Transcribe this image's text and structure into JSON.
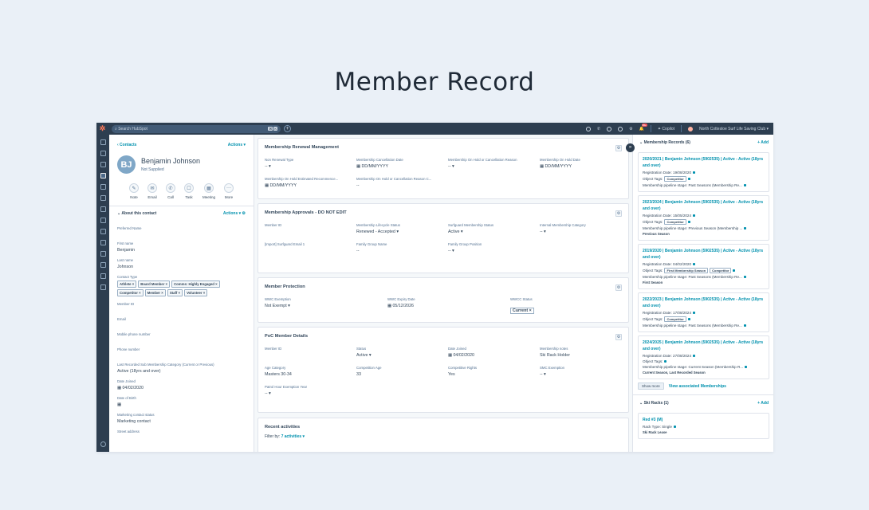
{
  "page_title": "Member Record",
  "topbar": {
    "search_placeholder": "Search HubSpot",
    "kbd1": "⌘",
    "kbd2": "K",
    "notif_count": "99+",
    "copilot": "Copilot",
    "account": "North Cottesloe Surf Life Saving Club ▾"
  },
  "contact": {
    "breadcrumb": "‹ Contacts",
    "actions": "Actions ▾",
    "initials": "BJ",
    "name": "Benjamin Johnson",
    "subtitle": "Not Supplied",
    "quick_actions": [
      "Note",
      "Email",
      "Call",
      "Task",
      "Meeting",
      "More"
    ],
    "about_title": "About this contact",
    "about_actions": "Actions ▾",
    "fields": {
      "preferred_name": {
        "label": "Preferred Name",
        "value": ""
      },
      "first_name": {
        "label": "First name",
        "value": "Benjamin"
      },
      "last_name": {
        "label": "Last name",
        "value": "Johnson"
      },
      "contact_type": {
        "label": "Contact Type"
      },
      "member_id": {
        "label": "Member ID",
        "value": ""
      },
      "email": {
        "label": "Email",
        "value": ""
      },
      "mobile": {
        "label": "Mobile phone number",
        "value": ""
      },
      "phone": {
        "label": "Phone number",
        "value": ""
      },
      "last_category": {
        "label": "Last Recorded Sub Membership Category (Current or Previous)",
        "value": "Active (18yrs and over)"
      },
      "date_joined": {
        "label": "Date Joined",
        "value": "04/02/2020"
      },
      "dob": {
        "label": "Date of Birth",
        "value": ""
      },
      "marketing_status": {
        "label": "Marketing contact status",
        "value": "Marketing contact"
      },
      "street": {
        "label": "Street address",
        "value": ""
      }
    },
    "contact_tags": [
      "Athlete ×",
      "Board Member ×",
      "Comms: Highly Engaged ×",
      "Competitor ×",
      "Member ×",
      "Staff ×",
      "Volunteer ×"
    ]
  },
  "cards": {
    "renewal": {
      "title": "Membership Renewal Management",
      "fields": [
        {
          "label": "Non Renewal Type",
          "value": "-- ▾"
        },
        {
          "label": "Membership Cancellation Date",
          "value": "▦ DD/MM/YYYY"
        },
        {
          "label": "Membership On Hold or Cancellation Reason",
          "value": "-- ▾"
        },
        {
          "label": "Membership On Hold Date",
          "value": "▦ DD/MM/YYYY"
        },
        {
          "label": "Membership On Hold Estimated Recommence...",
          "value": "▦ DD/MM/YYYY"
        },
        {
          "label": "Membership On Hold or Cancellation Reason C...",
          "value": "--"
        }
      ]
    },
    "approvals": {
      "title": "Membership Approvals - DO NOT EDIT",
      "fields": [
        {
          "label": "Member ID",
          "value": ""
        },
        {
          "label": "Membership Lifecycle Status",
          "value": "Renewed - Accepted ▾"
        },
        {
          "label": "Surfguard Membership Status",
          "value": "Active ▾"
        },
        {
          "label": "Internal Membership Category",
          "value": "-- ▾"
        },
        {
          "label": "[Import] Surfguard Email 1",
          "value": ""
        },
        {
          "label": "Family Group Name",
          "value": "--"
        },
        {
          "label": "Family Group Position",
          "value": "-- ▾"
        }
      ]
    },
    "protection": {
      "title": "Member Protection",
      "fields": [
        {
          "label": "WWC Exemption",
          "value": "Not Exempt ▾"
        },
        {
          "label": "WWC Expiry Date",
          "value": "▦ 05/12/2026"
        },
        {
          "label": "WWCC Status",
          "value": "Current ×"
        }
      ]
    },
    "poc": {
      "title": "PoC Member Details",
      "fields": [
        {
          "label": "Member ID",
          "value": ""
        },
        {
          "label": "Status",
          "value": "Active ▾"
        },
        {
          "label": "Date Joined",
          "value": "▦ 04/02/2020"
        },
        {
          "label": "Membership notes",
          "value": "Ski Rack Holder"
        },
        {
          "label": "Age Category",
          "value": "Masters 30-34"
        },
        {
          "label": "Competition Age",
          "value": "33"
        },
        {
          "label": "Competitive Rights",
          "value": "Yes"
        },
        {
          "label": "SMC Exemption",
          "value": "-- ▾"
        },
        {
          "label": "Patrol Hour Exemption Year",
          "value": "-- ▾"
        }
      ]
    },
    "activities": {
      "title": "Recent activities",
      "filter_label": "Filter by:",
      "filter_value": "7 activities ▾"
    }
  },
  "right": {
    "membership_title": "Membership Records (6)",
    "add": "+ Add",
    "records": [
      {
        "title": "2020/2021 | Benjamin Johnson (5902535) | Active - Active (18yrs and over)",
        "reg": "Registration Date: 19/08/2020",
        "tags": [
          "Competitor"
        ],
        "stage": "Membership pipeline stage: Past Seasons (Membership Re...",
        "sub": ""
      },
      {
        "title": "2023/2024 | Benjamin Johnson (5902535) | Active - Active (18yrs and over)",
        "reg": "Registration Date: 15/05/2024",
        "tags": [
          "Competitor"
        ],
        "stage": "Membership pipeline stage: Previous Season (Membership ...",
        "sub": "Previous Season"
      },
      {
        "title": "2019/2020 | Benjamin Johnson (5902535) | Active - Active (18yrs and over)",
        "reg": "Registration Date: 04/02/2020",
        "tags": [
          "First Membership Season",
          "Competitor"
        ],
        "stage": "Membership pipeline stage: Past Seasons (Membership Re...",
        "sub": "First Season"
      },
      {
        "title": "2022/2023 | Benjamin Johnson (5902535) | Active - Active (18yrs and over)",
        "reg": "Registration Date: 17/08/2024",
        "tags": [
          "Competitor"
        ],
        "stage": "Membership pipeline stage: Past Seasons (Membership Re...",
        "sub": ""
      },
      {
        "title": "2024/2025 | Benjamin Johnson (5902535) | Active - Active (18yrs and over)",
        "reg": "Registration Date: 27/08/2024",
        "tags": [],
        "stage": "Membership pipeline stage: Current Season (Membership R...",
        "sub": "Current Season, Last Recorded Season"
      }
    ],
    "object_tags_label": "Object Tags:",
    "show_more": "Show more",
    "view_assoc": "View associated Memberships",
    "ski_title": "Ski Racks (1)",
    "ski_add": "+ Add",
    "ski_item": {
      "title": "Red #3 (M)",
      "type": "Rack Type: Single",
      "sub": "Ski Rack Lease"
    }
  }
}
